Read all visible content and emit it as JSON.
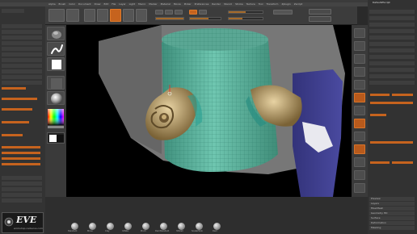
{
  "menubar": {
    "items": [
      "Alpha",
      "Brush",
      "Color",
      "Document",
      "Draw",
      "Edit",
      "File",
      "Layer",
      "Light",
      "Macro",
      "Marker",
      "Material",
      "Movie",
      "Picker",
      "Preferences",
      "Render",
      "Stencil",
      "Stroke",
      "Texture",
      "Tool",
      "Transform",
      "Zplugin",
      "Zscript"
    ]
  },
  "right_panel": {
    "title": "DefaultZScript",
    "items": [
      "Preview",
      "Subtool",
      "Geometry",
      "Layers",
      "FiberMesh",
      "Geometry HD",
      "Preview",
      "Surface",
      "Deformation",
      "Masking"
    ]
  },
  "watermark": {
    "logo_text": "EVE",
    "sub_text": "workshop.cerberus.com"
  },
  "bottom_bar": {
    "brushes": [
      "Standard",
      "Move",
      "Clay",
      "Inflate",
      "Pinch",
      "DamStandard",
      "hPolish",
      "SnakeHook",
      "Dam"
    ]
  },
  "colors": {
    "accent": "#c6631e",
    "mesh": "#5fb9a2",
    "cloth": "#3f3f8c",
    "horn": "#c2a56c"
  }
}
